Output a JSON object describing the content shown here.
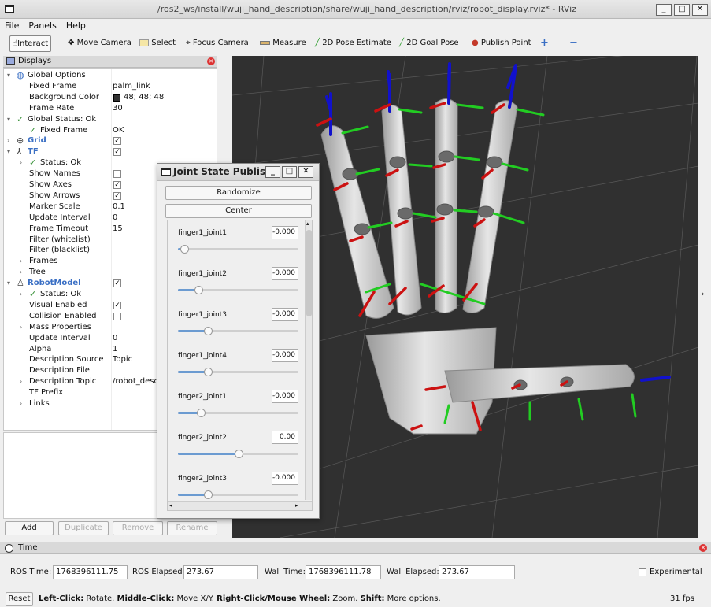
{
  "window": {
    "title": "/ros2_ws/install/wuji_hand_description/share/wuji_hand_description/rviz/robot_display.rviz* - RViz",
    "buttons": [
      "_",
      "□",
      "✕"
    ]
  },
  "menu": [
    "File",
    "Panels",
    "Help"
  ],
  "toolbar": {
    "interact": "Interact",
    "move_camera": "Move Camera",
    "select": "Select",
    "focus_camera": "Focus Camera",
    "measure": "Measure",
    "pose_estimate": "2D Pose Estimate",
    "goal_pose": "2D Goal Pose",
    "publish_point": "Publish Point"
  },
  "displays": {
    "title": "Displays",
    "rows": [
      {
        "label": "Global Options",
        "value": "",
        "indent": 1,
        "arrow": "▾",
        "icon": "globe-icon",
        "check": ""
      },
      {
        "label": "Fixed Frame",
        "value": "palm_link",
        "indent": 2,
        "arrow": "",
        "icon": "",
        "check": ""
      },
      {
        "label": "Background Color",
        "value": "48; 48; 48",
        "indent": 2,
        "arrow": "",
        "icon": "",
        "check": "",
        "swatch": "#303030"
      },
      {
        "label": "Frame Rate",
        "value": "30",
        "indent": 2,
        "arrow": "",
        "icon": "",
        "check": ""
      },
      {
        "label": "Global Status: Ok",
        "value": "",
        "indent": 1,
        "arrow": "▾",
        "icon": "checkmark-icon",
        "check": ""
      },
      {
        "label": "Fixed Frame",
        "value": "OK",
        "indent": 2,
        "arrow": "",
        "icon": "checkmark-icon",
        "check": ""
      },
      {
        "label": "Grid",
        "value": "",
        "indent": 1,
        "arrow": "›",
        "icon": "grid-icon",
        "check": "true",
        "blue": true
      },
      {
        "label": "TF",
        "value": "",
        "indent": 1,
        "arrow": "▾",
        "icon": "tf-icon",
        "check": "true",
        "blue": true
      },
      {
        "label": "Status: Ok",
        "value": "",
        "indent": 2,
        "arrow": "›",
        "icon": "checkmark-icon",
        "check": ""
      },
      {
        "label": "Show Names",
        "value": "",
        "indent": 2,
        "arrow": "",
        "icon": "",
        "check": "false"
      },
      {
        "label": "Show Axes",
        "value": "",
        "indent": 2,
        "arrow": "",
        "icon": "",
        "check": "true"
      },
      {
        "label": "Show Arrows",
        "value": "",
        "indent": 2,
        "arrow": "",
        "icon": "",
        "check": "true"
      },
      {
        "label": "Marker Scale",
        "value": "0.1",
        "indent": 2,
        "arrow": "",
        "icon": "",
        "check": ""
      },
      {
        "label": "Update Interval",
        "value": "0",
        "indent": 2,
        "arrow": "",
        "icon": "",
        "check": ""
      },
      {
        "label": "Frame Timeout",
        "value": "15",
        "indent": 2,
        "arrow": "",
        "icon": "",
        "check": ""
      },
      {
        "label": "Filter (whitelist)",
        "value": "",
        "indent": 2,
        "arrow": "",
        "icon": "",
        "check": ""
      },
      {
        "label": "Filter (blacklist)",
        "value": "",
        "indent": 2,
        "arrow": "",
        "icon": "",
        "check": ""
      },
      {
        "label": "Frames",
        "value": "",
        "indent": 2,
        "arrow": "›",
        "icon": "",
        "check": ""
      },
      {
        "label": "Tree",
        "value": "",
        "indent": 2,
        "arrow": "›",
        "icon": "",
        "check": ""
      },
      {
        "label": "RobotModel",
        "value": "",
        "indent": 1,
        "arrow": "▾",
        "icon": "robot-icon",
        "check": "true",
        "blue": true
      },
      {
        "label": "Status: Ok",
        "value": "",
        "indent": 2,
        "arrow": "›",
        "icon": "checkmark-icon",
        "check": ""
      },
      {
        "label": "Visual Enabled",
        "value": "",
        "indent": 2,
        "arrow": "",
        "icon": "",
        "check": "true"
      },
      {
        "label": "Collision Enabled",
        "value": "",
        "indent": 2,
        "arrow": "",
        "icon": "",
        "check": "false"
      },
      {
        "label": "Mass Properties",
        "value": "",
        "indent": 2,
        "arrow": "›",
        "icon": "",
        "check": ""
      },
      {
        "label": "Update Interval",
        "value": "0",
        "indent": 2,
        "arrow": "",
        "icon": "",
        "check": ""
      },
      {
        "label": "Alpha",
        "value": "1",
        "indent": 2,
        "arrow": "",
        "icon": "",
        "check": ""
      },
      {
        "label": "Description Source",
        "value": "Topic",
        "indent": 2,
        "arrow": "",
        "icon": "",
        "check": ""
      },
      {
        "label": "Description File",
        "value": "",
        "indent": 2,
        "arrow": "",
        "icon": "",
        "check": ""
      },
      {
        "label": "Description Topic",
        "value": "/robot_descr",
        "indent": 2,
        "arrow": "›",
        "icon": "",
        "check": ""
      },
      {
        "label": "TF Prefix",
        "value": "",
        "indent": 2,
        "arrow": "",
        "icon": "",
        "check": ""
      },
      {
        "label": "Links",
        "value": "",
        "indent": 2,
        "arrow": "›",
        "icon": "",
        "check": ""
      }
    ],
    "buttons": {
      "add": "Add",
      "duplicate": "Duplicate",
      "remove": "Remove",
      "rename": "Rename"
    }
  },
  "joint_state_publisher": {
    "title": "Joint State Publis...",
    "randomize": "Randomize",
    "center": "Center",
    "joints": [
      {
        "name": "finger1_joint1",
        "value": "-0.000",
        "fraction": 0.05
      },
      {
        "name": "finger1_joint2",
        "value": "-0.000",
        "fraction": 0.17
      },
      {
        "name": "finger1_joint3",
        "value": "-0.000",
        "fraction": 0.25
      },
      {
        "name": "finger1_joint4",
        "value": "-0.000",
        "fraction": 0.25
      },
      {
        "name": "finger2_joint1",
        "value": "-0.000",
        "fraction": 0.19
      },
      {
        "name": "finger2_joint2",
        "value": "0.00",
        "fraction": 0.5
      },
      {
        "name": "finger2_joint3",
        "value": "-0.000",
        "fraction": 0.25
      }
    ]
  },
  "time": {
    "title": "Time",
    "ros_time_label": "ROS Time:",
    "ros_time": "1768396111.75",
    "ros_elapsed_label": "ROS Elapsed:",
    "ros_elapsed": "273.67",
    "wall_time_label": "Wall Time:",
    "wall_time": "1768396111.78",
    "wall_elapsed_label": "Wall Elapsed:",
    "wall_elapsed": "273.67",
    "experimental": "Experimental"
  },
  "status": {
    "reset": "Reset",
    "k1": "Left-Click:",
    "t1": " Rotate. ",
    "k2": "Middle-Click:",
    "t2": " Move X/Y. ",
    "k3": "Right-Click/Mouse Wheel:",
    "t3": " Zoom. ",
    "k4": "Shift:",
    "t4": " More options.",
    "fps": "31 fps"
  },
  "colors": {
    "viewport_bg": "#303030",
    "accent": "#3a6fc4",
    "x_axis": "#cc1111",
    "y_axis": "#22cc22",
    "z_axis": "#1111cc"
  }
}
